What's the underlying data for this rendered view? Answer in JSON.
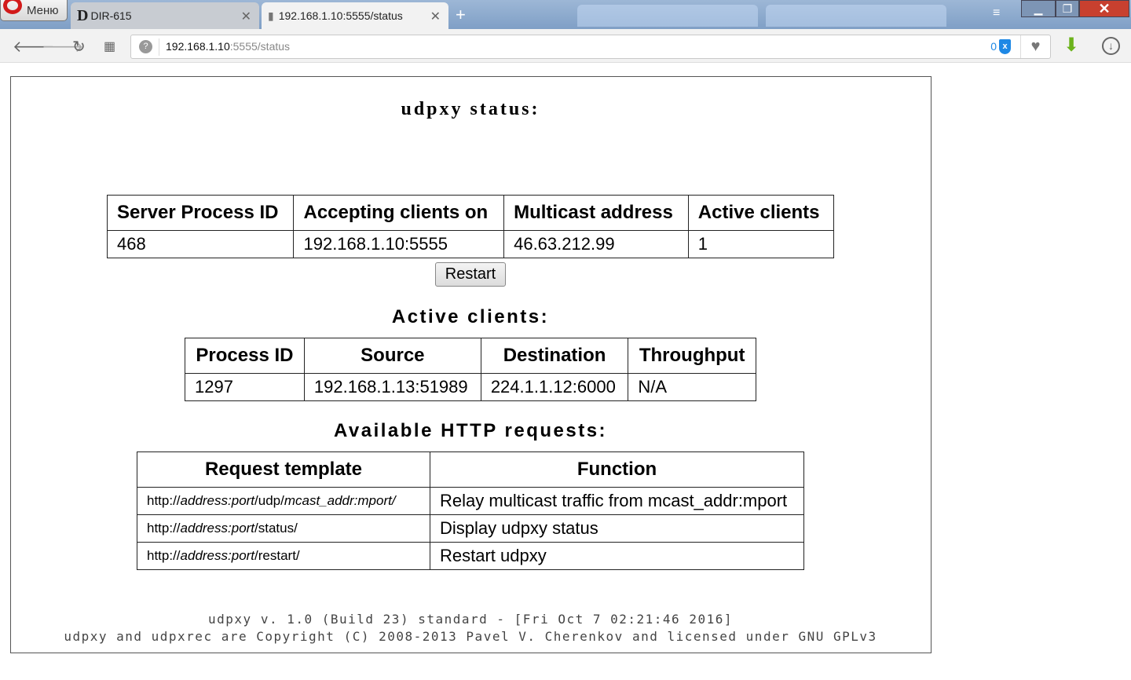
{
  "browser": {
    "menu_label": "Меню",
    "tabs": [
      {
        "label": "DIR-615"
      },
      {
        "label": "192.168.1.10:5555/status"
      }
    ],
    "url_host": "192.168.1.10",
    "url_rest": ":5555/status",
    "blocked_count": "0"
  },
  "page": {
    "title": "udpxy status:",
    "server_table": {
      "headers": [
        "Server Process ID",
        "Accepting clients on",
        "Multicast address",
        "Active clients"
      ],
      "row": [
        "468",
        "192.168.1.10:5555",
        "46.63.212.99",
        "1"
      ]
    },
    "restart_label": "Restart",
    "clients_heading": "Active clients:",
    "clients_table": {
      "headers": [
        "Process ID",
        "Source",
        "Destination",
        "Throughput"
      ],
      "row": [
        "1297",
        "192.168.1.13:51989",
        "224.1.1.12:6000",
        "N/A"
      ]
    },
    "requests_heading": "Available HTTP requests:",
    "requests_table": {
      "headers": [
        "Request template",
        "Function"
      ],
      "rows": [
        {
          "p1": "http://",
          "p2": "address:port",
          "p3": "/udp/",
          "p4": "mcast_addr:mport/",
          "p5": "",
          "fn": "Relay multicast traffic from mcast_addr:mport"
        },
        {
          "p1": "http://",
          "p2": "address:port",
          "p3": "/status/",
          "p4": "",
          "p5": "",
          "fn": "Display udpxy status"
        },
        {
          "p1": "http://",
          "p2": "address:port",
          "p3": "/restart/",
          "p4": "",
          "p5": "",
          "fn": "Restart udpxy"
        }
      ]
    },
    "footer": {
      "line1": "udpxy v. 1.0 (Build 23) standard - [Fri Oct 7 02:21:46 2016]",
      "line2": "udpxy and udpxrec are Copyright (C) 2008-2013 Pavel V. Cherenkov and licensed under GNU GPLv3"
    }
  }
}
